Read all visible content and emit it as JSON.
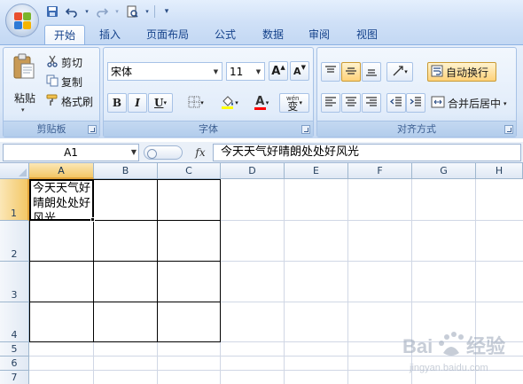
{
  "tabs": [
    {
      "label": "开始",
      "active": true
    },
    {
      "label": "插入"
    },
    {
      "label": "页面布局"
    },
    {
      "label": "公式"
    },
    {
      "label": "数据"
    },
    {
      "label": "审阅"
    },
    {
      "label": "视图"
    }
  ],
  "clipboard": {
    "paste_label": "粘贴",
    "cut_label": "剪切",
    "copy_label": "复制",
    "format_painter_label": "格式刷",
    "group_label": "剪贴板"
  },
  "font": {
    "name": "宋体",
    "size": "11",
    "grow_label": "A",
    "shrink_label": "A",
    "bold_label": "B",
    "italic_label": "I",
    "underline_label": "U",
    "font_color_letter": "A",
    "phonetic_label": "wén",
    "phonetic_char": "变",
    "group_label": "字体"
  },
  "alignment": {
    "wrap_text_label": "自动换行",
    "merge_center_label": "合并后居中",
    "group_label": "对齐方式"
  },
  "formula_bar": {
    "name_box": "A1",
    "fx_label": "fx",
    "content": "今天天气好晴朗处处好风光"
  },
  "grid": {
    "columns": [
      "A",
      "B",
      "C",
      "D",
      "E",
      "F",
      "G",
      "H"
    ],
    "rows": [
      "1",
      "2",
      "3",
      "4",
      "5",
      "6",
      "7"
    ],
    "cell_a1": "今天天气好晴朗处处好风光"
  },
  "colors": {
    "accent": "#15428b",
    "selection": "#f3c766",
    "font_color": "#ff0000",
    "fill_color": "#ffff00"
  },
  "watermark": {
    "brand": "Baidu经验",
    "url": "jingyan.baidu.com"
  }
}
